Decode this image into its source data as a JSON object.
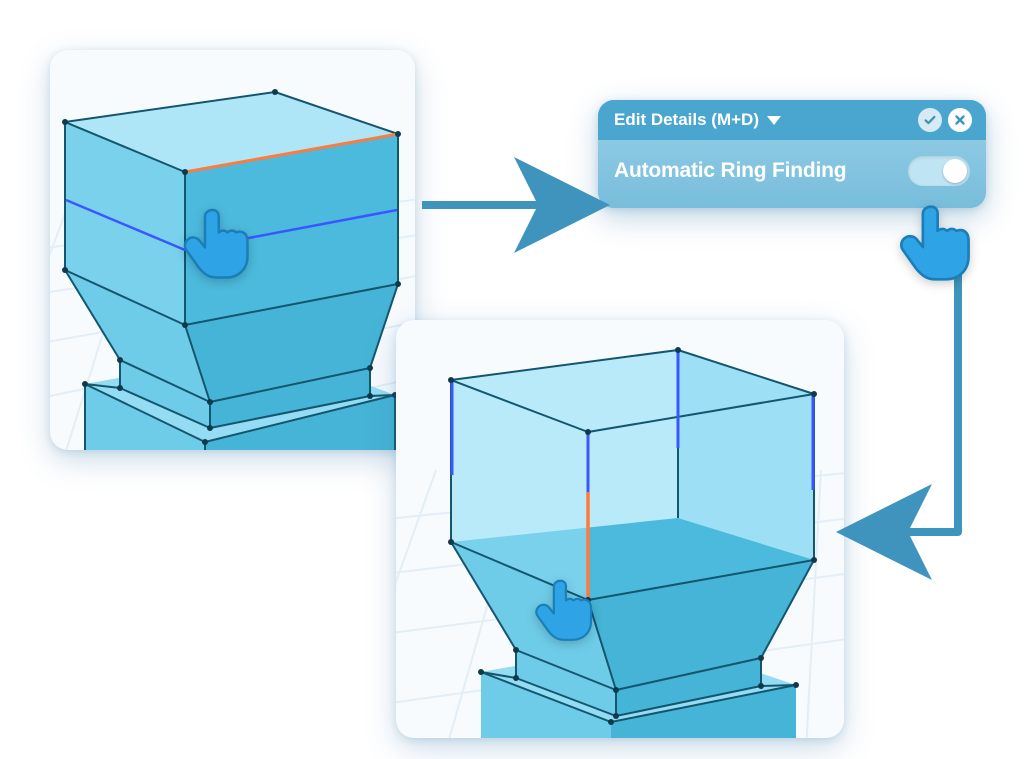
{
  "panel": {
    "title": "Edit Details (M+D)",
    "setting_label": "Automatic Ring Finding",
    "toggle_state": "on"
  },
  "colors": {
    "accent": "#3e94bd",
    "face_light": "#93dcf4",
    "face_mid": "#6ecce8",
    "face_dark": "#46b4d6",
    "edge": "#13566e",
    "highlight_ring": "#3a57ff",
    "highlight_select": "#ff7a3c",
    "grid": "#e3eef6",
    "cursor": "#2ea4e6"
  },
  "icons": {
    "confirm": "check",
    "close": "x",
    "dropdown": "triangle-down",
    "cursor": "pointing-hand"
  }
}
